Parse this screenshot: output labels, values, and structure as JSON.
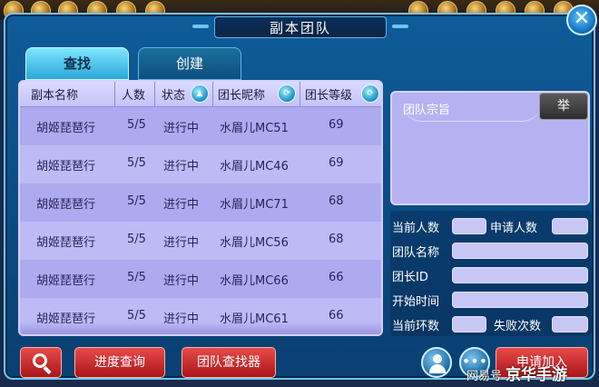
{
  "window": {
    "title": "副本团队",
    "close_symbol": "✕"
  },
  "tabs": [
    {
      "label": "查找",
      "active": true
    },
    {
      "label": "创建",
      "active": false
    }
  ],
  "table": {
    "columns": [
      {
        "label": "副本名称",
        "sortable": false
      },
      {
        "label": "人数",
        "sortable": false
      },
      {
        "label": "状态",
        "sortable": true,
        "sort_icon": "triangle-up-icon"
      },
      {
        "label": "团长昵称",
        "sortable": true,
        "sort_icon": "circle-arrow-icon"
      },
      {
        "label": "团长等级",
        "sortable": true,
        "sort_icon": "circle-arrow-icon"
      }
    ],
    "rows": [
      [
        "胡姬琵琶行",
        "5/5",
        "进行中",
        "水眉儿MC51",
        "69"
      ],
      [
        "胡姬琵琶行",
        "5/5",
        "进行中",
        "水眉儿MC46",
        "69"
      ],
      [
        "胡姬琵琶行",
        "5/5",
        "进行中",
        "水眉儿MC71",
        "68"
      ],
      [
        "胡姬琵琶行",
        "5/5",
        "进行中",
        "水眉儿MC56",
        "68"
      ],
      [
        "胡姬琵琶行",
        "5/5",
        "进行中",
        "水眉儿MC66",
        "66"
      ],
      [
        "胡姬琵琶行",
        "5/5",
        "进行中",
        "水眉儿MC61",
        "66"
      ]
    ]
  },
  "team_info": {
    "purpose_label": "团队宗旨",
    "report_button": "举",
    "current_members_label": "当前人数",
    "applicants_label": "申请人数",
    "team_name_label": "团队名称",
    "leader_id_label": "团长ID",
    "start_time_label": "开始时间",
    "current_round_label": "当前环数",
    "failures_label": "失败次数"
  },
  "bottom": {
    "progress_query": "进度查询",
    "team_finder": "团队查找器",
    "apply_join": "申请加入"
  },
  "watermark": {
    "source": "网易号",
    "brand": "京华手游"
  },
  "colors": {
    "window_bg": "#0e5c9a",
    "table_bg": "#b7b4f2",
    "button_red": "#c8262a"
  }
}
